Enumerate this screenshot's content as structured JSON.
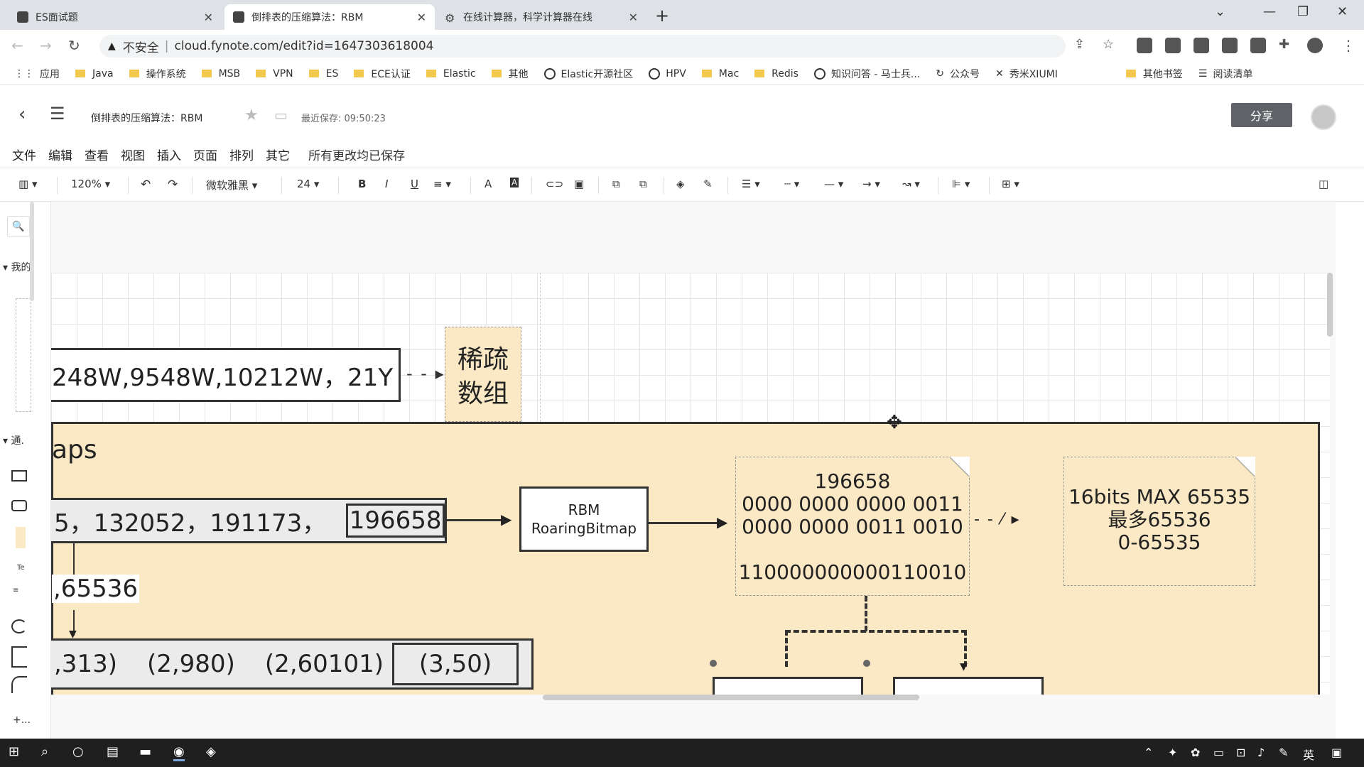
{
  "browser": {
    "tabs": [
      {
        "title": "ES面试题",
        "active": false
      },
      {
        "title": "倒排表的压缩算法：RBM",
        "active": true
      },
      {
        "title": "在线计算器，科学计算器在线",
        "active": false
      }
    ],
    "security_label": "不安全",
    "url": "cloud.fynote.com/edit?id=1647303618004",
    "bookmarks": [
      "应用",
      "Java",
      "操作系统",
      "MSB",
      "VPN",
      "ES",
      "ECE认证",
      "Elastic",
      "其他",
      "Elastic开源社区",
      "HPV",
      "Mac",
      "Redis",
      "知识问答 - 马士兵...",
      "公众号",
      "秀米XIUMI"
    ],
    "bookmarks_right": [
      "其他书签",
      "阅读清单"
    ]
  },
  "app": {
    "doc_title": "倒排表的压缩算法：RBM",
    "last_saved": "最近保存: 09:50:23",
    "share_label": "分享",
    "menus": [
      "文件",
      "编辑",
      "查看",
      "视图",
      "插入",
      "页面",
      "排列",
      "其它"
    ],
    "save_status": "所有更改均已保存",
    "toolbar": {
      "zoom": "120%",
      "font": "微软雅黑",
      "font_size": "24",
      "bold": "B",
      "italic": "I",
      "underline": "U",
      "font_color": "A"
    },
    "left_panel": {
      "my_shapes": "我的",
      "general": "通.",
      "more": "+..."
    }
  },
  "diagram": {
    "top_box_text": "248W,9548W,10212W，21Y",
    "sparse_note": [
      "稀疏",
      "数组"
    ],
    "container_title": "aps",
    "row1_text": "5，132052，191173，",
    "row1_highlight": "196658",
    "divisor_label": ",65536",
    "row2_cells": [
      ",313)",
      "(2,980)",
      "(2,60101)"
    ],
    "row2_highlight": "(3,50)",
    "rbm_box": [
      "RBM",
      "RoaringBitmap"
    ],
    "binary_note": [
      "196658",
      "0000 0000 0000 0011",
      "0000 0000 0011 0010",
      "",
      "110000000000110010"
    ],
    "max_note": [
      "16bits MAX 65535",
      "最多65536",
      "0-65535"
    ]
  },
  "colors": {
    "container_fill": "#fbe8c4",
    "share_button": "#5f6368",
    "taskbar": "#1f1f1f"
  }
}
